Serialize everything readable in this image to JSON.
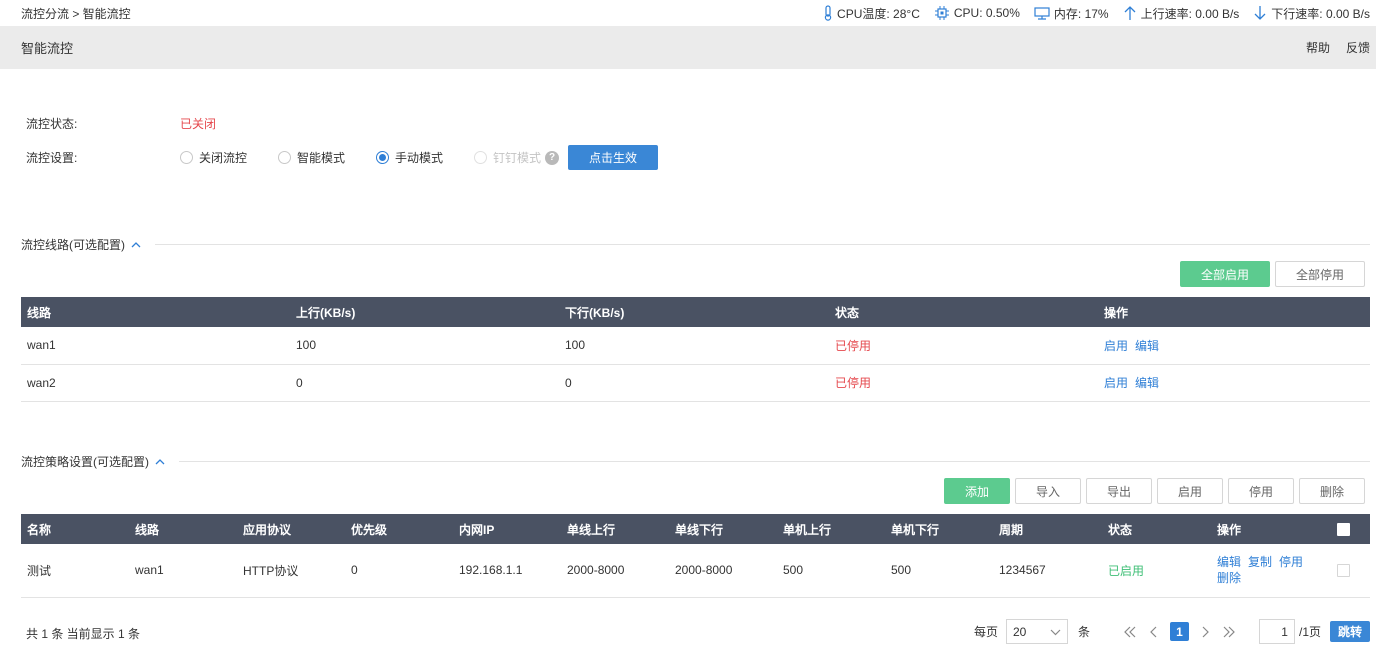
{
  "breadcrumb": "流控分流 > 智能流控",
  "stats": {
    "cpu_temp": "CPU温度: 28°C",
    "cpu": "CPU: 0.50%",
    "memory": "内存: 17%",
    "upload": "上行速率: 0.00 B/s",
    "download": "下行速率: 0.00 B/s"
  },
  "page": {
    "title": "智能流控",
    "help": "帮助",
    "feedback": "反馈"
  },
  "form": {
    "status_label": "流控状态:",
    "status_value": "已关闭",
    "setting_label": "流控设置:",
    "options": [
      "关闭流控",
      "智能模式",
      "手动模式",
      "钉钉模式"
    ],
    "selected": "手动模式",
    "apply_button": "点击生效"
  },
  "lines_section": {
    "title": "流控线路(可选配置)",
    "enable_all": "全部启用",
    "disable_all": "全部停用",
    "columns": [
      "线路",
      "上行(KB/s)",
      "下行(KB/s)",
      "状态",
      "操作"
    ],
    "rows": [
      {
        "line": "wan1",
        "up": "100",
        "down": "100",
        "status": "已停用",
        "op1": "启用",
        "op2": "编辑"
      },
      {
        "line": "wan2",
        "up": "0",
        "down": "0",
        "status": "已停用",
        "op1": "启用",
        "op2": "编辑"
      }
    ]
  },
  "policy_section": {
    "title": "流控策略设置(可选配置)",
    "buttons": {
      "add": "添加",
      "import": "导入",
      "export": "导出",
      "enable": "启用",
      "disable": "停用",
      "delete": "删除"
    },
    "columns": [
      "名称",
      "线路",
      "应用协议",
      "优先级",
      "内网IP",
      "单线上行",
      "单线下行",
      "单机上行",
      "单机下行",
      "周期",
      "状态",
      "操作"
    ],
    "rows": [
      {
        "name": "测试",
        "line": "wan1",
        "protocol": "HTTP协议",
        "priority": "0",
        "ip": "192.168.1.1",
        "line_up": "2000-8000",
        "line_down": "2000-8000",
        "host_up": "500",
        "host_down": "500",
        "cycle": "1234567",
        "status": "已启用",
        "op_edit": "编辑",
        "op_copy": "复制",
        "op_disable": "停用",
        "op_delete": "删除"
      }
    ]
  },
  "pagination": {
    "summary": "共 1 条 当前显示 1 条",
    "per_page_label": "每页",
    "per_page_value": "20",
    "per_page_unit": "条",
    "current_page": "1",
    "jump_value": "1",
    "total_pages": "/1页",
    "jump_button": "跳转"
  },
  "colors": {
    "header_bg": "#4a5263",
    "primary": "#3a87d6",
    "green": "#5ccb8f",
    "danger": "#e5484d"
  }
}
